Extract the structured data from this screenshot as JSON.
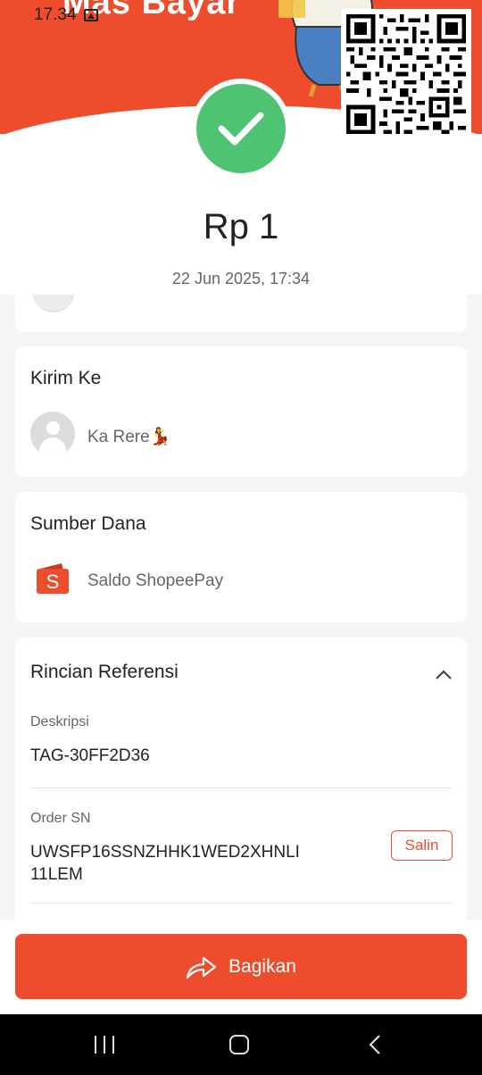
{
  "status_bar": {
    "time": "17.34"
  },
  "banner": {
    "text": "Mas Bayar"
  },
  "transaction": {
    "amount": "Rp 1",
    "datetime": "22 Jun 2025, 17:34"
  },
  "recipient": {
    "title": "Kirim Ke",
    "name": "Ka Rere💃"
  },
  "funding": {
    "title": "Sumber Dana",
    "source": "Saldo ShopeePay"
  },
  "reference": {
    "title": "Rincian Referensi",
    "description_label": "Deskripsi",
    "description_value": "TAG-30FF2D36",
    "order_label": "Order SN",
    "order_value_line1": "UWSFP16SSNZHHK1WED2XHNLI",
    "order_value_line2": "11LEM",
    "copy_label": "Salin"
  },
  "footer": {
    "share_label": "Bagikan"
  },
  "colors": {
    "brand": "#ee4d2d",
    "success": "#4ec472"
  },
  "icons": [
    "image-icon",
    "qr-code",
    "check-icon",
    "avatar-placeholder-icon",
    "shopeepay-wallet-icon",
    "chevron-up-icon",
    "share-arrow-icon",
    "recents-icon",
    "home-icon",
    "back-icon"
  ]
}
